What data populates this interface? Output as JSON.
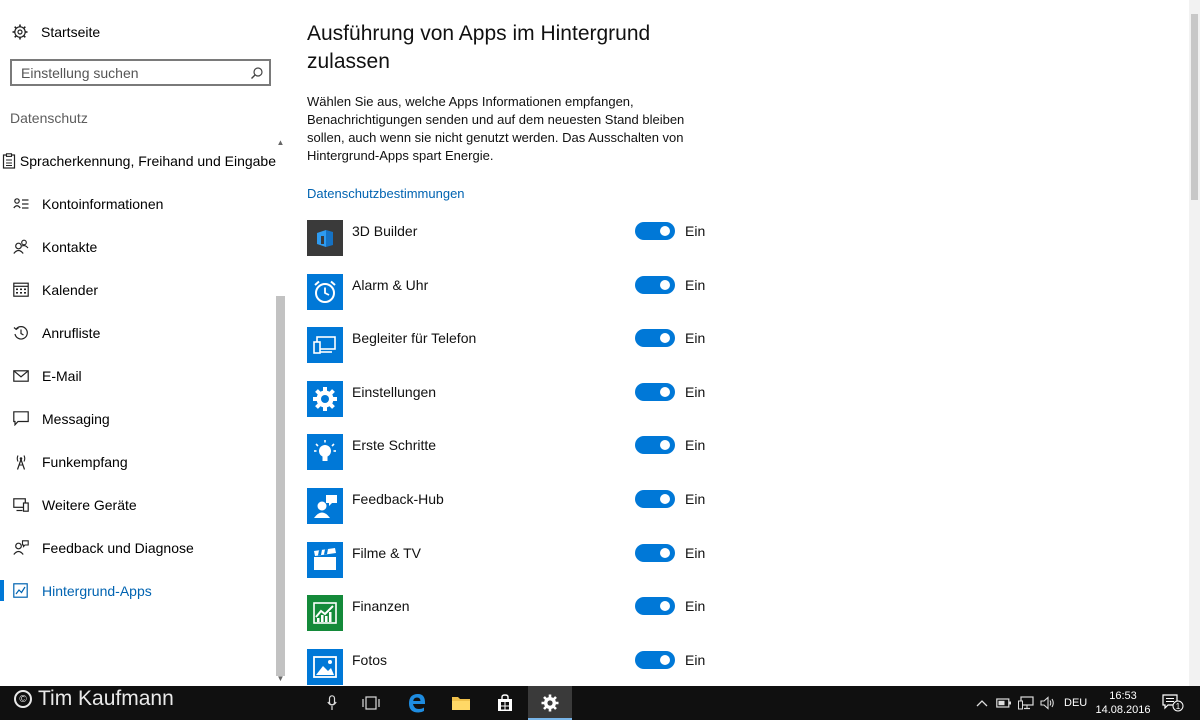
{
  "sidebar": {
    "home_label": "Startseite",
    "search_placeholder": "Einstellung suchen",
    "section_label": "Datenschutz",
    "items": [
      {
        "label": "Spracherkennung, Freihand und Eingabe",
        "icon": "clipboard-icon"
      },
      {
        "label": "Kontoinformationen",
        "icon": "account-info-icon"
      },
      {
        "label": "Kontakte",
        "icon": "contacts-icon"
      },
      {
        "label": "Kalender",
        "icon": "calendar-icon"
      },
      {
        "label": "Anrufliste",
        "icon": "history-icon"
      },
      {
        "label": "E-Mail",
        "icon": "mail-icon"
      },
      {
        "label": "Messaging",
        "icon": "message-icon"
      },
      {
        "label": "Funkempfang",
        "icon": "radio-tower-icon"
      },
      {
        "label": "Weitere Geräte",
        "icon": "devices-icon"
      },
      {
        "label": "Feedback und Diagnose",
        "icon": "feedback-icon"
      },
      {
        "label": "Hintergrund-Apps",
        "icon": "background-apps-icon",
        "active": true
      }
    ]
  },
  "main": {
    "title": "Ausführung von Apps im Hintergrund zulassen",
    "description": "Wählen Sie aus, welche Apps Informationen empfangen, Benachrichtigungen senden und auf dem neuesten Stand bleiben sollen, auch wenn sie nicht genutzt werden. Das Ausschalten von Hintergrund-Apps spart Energie.",
    "privacy_link": "Datenschutzbestimmungen",
    "apps": [
      {
        "name": "3D Builder",
        "state": "Ein",
        "tile_color": "#3a3a3a",
        "icon": "3d-builder-icon"
      },
      {
        "name": "Alarm & Uhr",
        "state": "Ein",
        "tile_color": "#0078d7",
        "icon": "alarm-clock-icon"
      },
      {
        "name": "Begleiter für Telefon",
        "state": "Ein",
        "tile_color": "#0078d7",
        "icon": "phone-companion-icon"
      },
      {
        "name": "Einstellungen",
        "state": "Ein",
        "tile_color": "#0078d7",
        "icon": "settings-gear-icon"
      },
      {
        "name": "Erste Schritte",
        "state": "Ein",
        "tile_color": "#0078d7",
        "icon": "lightbulb-icon"
      },
      {
        "name": "Feedback-Hub",
        "state": "Ein",
        "tile_color": "#0078d7",
        "icon": "feedback-hub-icon"
      },
      {
        "name": "Filme & TV",
        "state": "Ein",
        "tile_color": "#0078d7",
        "icon": "film-clapper-icon"
      },
      {
        "name": "Finanzen",
        "state": "Ein",
        "tile_color": "#148a3a",
        "icon": "finance-chart-icon"
      },
      {
        "name": "Fotos",
        "state": "Ein",
        "tile_color": "#0078d7",
        "icon": "photos-icon"
      }
    ]
  },
  "taskbar": {
    "watermark": "Tim Kaufmann",
    "watermark_symbol": "©",
    "language": "DEU",
    "time": "16:53",
    "date": "14.08.2016",
    "notification_count": "1"
  },
  "colors": {
    "accent": "#0078d7",
    "link": "#0063b1",
    "taskbar": "#101010"
  }
}
